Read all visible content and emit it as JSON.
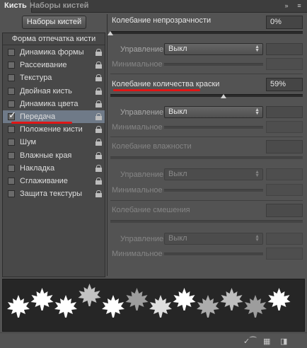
{
  "tabs": [
    {
      "label": "Кисть",
      "active": true
    },
    {
      "label": "Наборы кистей",
      "active": false
    }
  ],
  "window_controls": {
    "collapse": "»",
    "menu": "≡"
  },
  "presets_button": "Наборы кистей",
  "left_panel": {
    "header": "Форма отпечатка кисти",
    "items": [
      {
        "label": "Динамика формы",
        "checked": false,
        "selected": false
      },
      {
        "label": "Рассеивание",
        "checked": false,
        "selected": false
      },
      {
        "label": "Текстура",
        "checked": false,
        "selected": false
      },
      {
        "label": "Двойная кисть",
        "checked": false,
        "selected": false
      },
      {
        "label": "Динамика цвета",
        "checked": false,
        "selected": false
      },
      {
        "label": "Передача",
        "checked": true,
        "selected": true
      },
      {
        "label": "Положение кисти",
        "checked": false,
        "selected": false
      },
      {
        "label": "Шум",
        "checked": false,
        "selected": false
      },
      {
        "label": "Влажные края",
        "checked": false,
        "selected": false
      },
      {
        "label": "Накладка",
        "checked": false,
        "selected": false
      },
      {
        "label": "Сглаживание",
        "checked": false,
        "selected": false
      },
      {
        "label": "Защита текстуры",
        "checked": false,
        "selected": false
      }
    ]
  },
  "opacity_jitter": {
    "title": "Колебание непрозрачности",
    "value": "0%",
    "control_label": "Управление:",
    "control_value": "Выкл",
    "minimum_label": "Минимальное"
  },
  "flow_jitter": {
    "title": "Колебание количества краски",
    "value": "59%",
    "slider_fraction": 0.59,
    "control_label": "Управление:",
    "control_value": "Выкл",
    "minimum_label": "Минимальное"
  },
  "wetness_jitter": {
    "title": "Колебание влажности",
    "control_label": "Управление:",
    "control_value": "Выкл",
    "minimum_label": "Минимальное"
  },
  "mix_jitter": {
    "title": "Колебание смешения",
    "control_label": "Управление:",
    "control_value": "Выкл",
    "minimum_label": "Минимальное"
  },
  "preview": {
    "opacities": [
      1,
      1,
      1,
      0.72,
      1,
      0.55,
      0.85,
      1,
      0.62,
      0.7,
      0.55,
      1
    ]
  },
  "colors": {
    "panel": "#535353",
    "selected_row": "#6f7a88",
    "annotation_red": "#e01616"
  }
}
